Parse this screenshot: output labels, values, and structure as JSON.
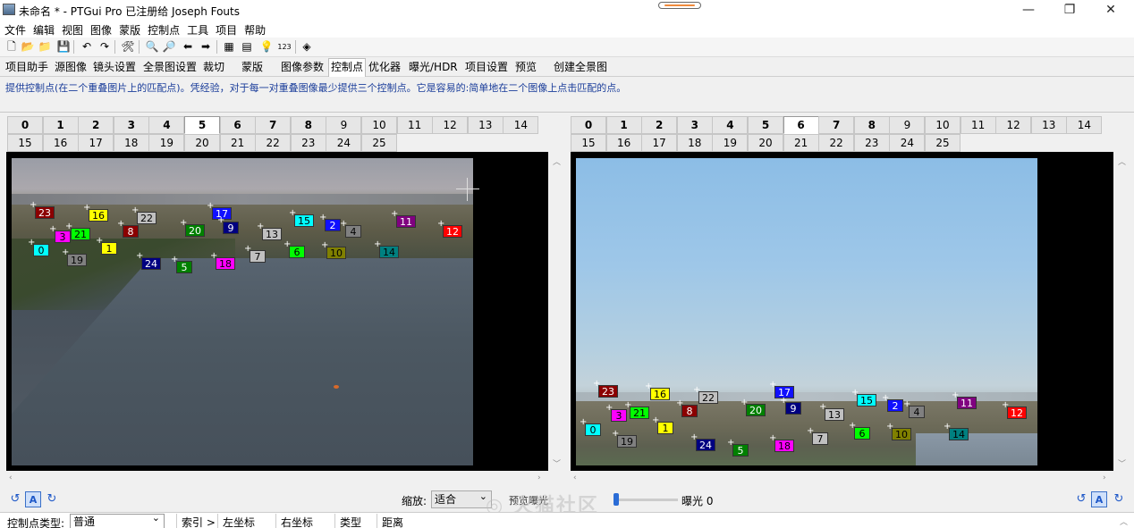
{
  "window": {
    "title": "未命名 * - PTGui Pro 已注册给 Joseph Fouts",
    "minimize": "—",
    "maximize": "❐",
    "close": "✕"
  },
  "menu": [
    "文件",
    "编辑",
    "视图",
    "图像",
    "蒙版",
    "控制点",
    "工具",
    "项目",
    "帮助"
  ],
  "toolbar": [
    {
      "icon": "new-file-icon",
      "glyph": "🗋"
    },
    {
      "icon": "open-folder-icon",
      "glyph": "📂"
    },
    {
      "icon": "open-recent-icon",
      "glyph": "📁"
    },
    {
      "icon": "save-icon",
      "glyph": "💾"
    },
    {
      "icon": "undo-icon",
      "glyph": "↶"
    },
    {
      "icon": "redo-icon",
      "glyph": "↷"
    },
    {
      "icon": "tools-icon",
      "glyph": "🛠"
    },
    {
      "icon": "zoom-in-icon",
      "glyph": "🔍"
    },
    {
      "icon": "zoom-out-icon",
      "glyph": "🔎"
    },
    {
      "icon": "previous-arrow-icon",
      "glyph": "⬅"
    },
    {
      "icon": "next-arrow-icon",
      "glyph": "➡"
    },
    {
      "icon": "batch-icon",
      "glyph": "▦"
    },
    {
      "icon": "table-icon",
      "glyph": "▤"
    },
    {
      "icon": "lightbulb-icon",
      "glyph": "💡"
    },
    {
      "icon": "numbering-icon",
      "glyph": "123"
    },
    {
      "icon": "publish-icon",
      "glyph": "◈"
    }
  ],
  "tabs": [
    "项目助手",
    "源图像",
    "镜头设置",
    "全景图设置",
    "裁切",
    "蒙版",
    "图像参数",
    "控制点",
    "优化器",
    "曝光/HDR",
    "项目设置",
    "预览",
    "创建全景图"
  ],
  "active_tab": "控制点",
  "hint": "提供控制点(在二个重叠图片上的匹配点)。凭经验，对于每一对重叠图像最少提供三个控制点。它是容易的:简单地在二个图像上点击匹配的点。",
  "image_numbers": [
    "0",
    "1",
    "2",
    "3",
    "4",
    "5",
    "6",
    "7",
    "8",
    "9",
    "10",
    "11",
    "12",
    "13",
    "14",
    "15",
    "16",
    "17",
    "18",
    "19",
    "20",
    "21",
    "22",
    "23",
    "24",
    "25"
  ],
  "left_viewer": {
    "selected_image": "5",
    "control_points": [
      {
        "id": "23",
        "color": "#8b0000",
        "text": "#fff"
      },
      {
        "id": "16",
        "color": "#ffff00",
        "text": "#000"
      },
      {
        "id": "22",
        "color": "#c0c0c0",
        "text": "#000"
      },
      {
        "id": "17",
        "color": "#1010ff",
        "text": "#fff"
      },
      {
        "id": "15",
        "color": "#00ffff",
        "text": "#000"
      },
      {
        "id": "2",
        "color": "#1010ff",
        "text": "#fff"
      },
      {
        "id": "11",
        "color": "#800080",
        "text": "#fff"
      },
      {
        "id": "12",
        "color": "#ff0000",
        "text": "#fff"
      },
      {
        "id": "3",
        "color": "#ff00ff",
        "text": "#000"
      },
      {
        "id": "21",
        "color": "#00ff00",
        "text": "#000"
      },
      {
        "id": "8",
        "color": "#8b0000",
        "text": "#fff"
      },
      {
        "id": "20",
        "color": "#008000",
        "text": "#fff"
      },
      {
        "id": "9",
        "color": "#000080",
        "text": "#fff"
      },
      {
        "id": "13",
        "color": "#c0c0c0",
        "text": "#000"
      },
      {
        "id": "4",
        "color": "#808080",
        "text": "#000"
      },
      {
        "id": "0",
        "color": "#00ffff",
        "text": "#000"
      },
      {
        "id": "1",
        "color": "#ffff00",
        "text": "#000"
      },
      {
        "id": "19",
        "color": "#808080",
        "text": "#000"
      },
      {
        "id": "24",
        "color": "#000080",
        "text": "#fff"
      },
      {
        "id": "5",
        "color": "#008000",
        "text": "#fff"
      },
      {
        "id": "18",
        "color": "#ff00ff",
        "text": "#000"
      },
      {
        "id": "7",
        "color": "#c0c0c0",
        "text": "#000"
      },
      {
        "id": "6",
        "color": "#00ff00",
        "text": "#000"
      },
      {
        "id": "10",
        "color": "#808000",
        "text": "#000"
      },
      {
        "id": "14",
        "color": "#008080",
        "text": "#000"
      }
    ]
  },
  "right_viewer": {
    "selected_image": "6"
  },
  "controls": {
    "zoom_label": "缩放:",
    "zoom_value": "适合",
    "preview_exposure": "预览曝光",
    "exposure_label": "曝光 0",
    "auto_label": "A",
    "watermark": "◎ 火猫社区"
  },
  "cp_table": {
    "type_label": "控制点类型:",
    "type_value": "普通",
    "columns": [
      "索引 >",
      "左坐标",
      "右坐标",
      "类型",
      "距离"
    ]
  }
}
